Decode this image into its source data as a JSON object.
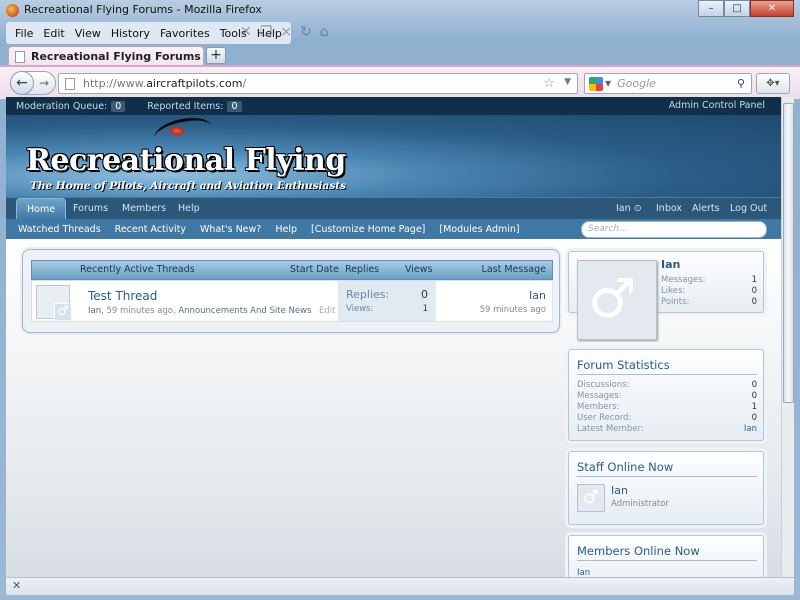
{
  "window": {
    "title": "Recreational Flying Forums - Mozilla Firefox",
    "controls": [
      "–",
      "□",
      "✕"
    ]
  },
  "menu": [
    "File",
    "Edit",
    "View",
    "History",
    "Favorites",
    "Tools",
    "Help"
  ],
  "tab": {
    "label": "Recreational Flying Forums",
    "new_tab": "+"
  },
  "nav": {
    "url_prefix": "http://www.",
    "url_domain": "aircraftpilots.com",
    "url_suffix": "/",
    "search_placeholder": "Google"
  },
  "admin_bar": {
    "moderation_label": "Moderation Queue:",
    "moderation_count": "0",
    "reported_label": "Reported Items:",
    "reported_count": "0",
    "control_panel": "Admin Control Panel"
  },
  "site": {
    "title": "Recreational Flying",
    "tagline": "The Home of Pilots, Aircraft and Aviation Enthusiasts"
  },
  "nav_tabs": {
    "home": "Home",
    "forums": "Forums",
    "members": "Members",
    "help": "Help",
    "user": "Ian",
    "inbox": "Inbox",
    "alerts": "Alerts",
    "logout": "Log Out"
  },
  "subnav": [
    "Watched Threads",
    "Recent Activity",
    "What's New?",
    "Help",
    "[Customize Home Page]",
    "[Modules Admin]"
  ],
  "page_search_placeholder": "Search...",
  "threads": {
    "headers": {
      "title": "Recently Active Threads",
      "start_date": "Start Date",
      "replies": "Replies",
      "views": "Views",
      "last_message": "Last Message"
    },
    "rows": [
      {
        "title": "Test Thread",
        "author": "Ian",
        "time": "59 minutes ago",
        "forum": "Announcements And Site News",
        "edit": "Edit",
        "replies_label": "Replies:",
        "replies": "0",
        "views_label": "Views:",
        "views": "1",
        "last_user": "Ian",
        "last_time": "59 minutes ago"
      }
    ]
  },
  "visitor": {
    "name": "Ian",
    "stats": [
      {
        "label": "Messages:",
        "value": "1"
      },
      {
        "label": "Likes:",
        "value": "0"
      },
      {
        "label": "Points:",
        "value": "0"
      }
    ]
  },
  "forum_stats": {
    "title": "Forum Statistics",
    "rows": [
      {
        "label": "Discussions:",
        "value": "0"
      },
      {
        "label": "Messages:",
        "value": "0"
      },
      {
        "label": "Members:",
        "value": "1"
      },
      {
        "label": "User Record:",
        "value": "0"
      },
      {
        "label": "Latest Member:",
        "value": "Ian"
      }
    ]
  },
  "staff_online": {
    "title": "Staff Online Now",
    "name": "Ian",
    "role": "Administrator"
  },
  "members_online": {
    "title": "Members Online Now",
    "list": "Ian"
  },
  "icons": {
    "avatar": "male-symbol-icon",
    "star": "bookmark-star-icon",
    "search": "magnifier-icon"
  }
}
